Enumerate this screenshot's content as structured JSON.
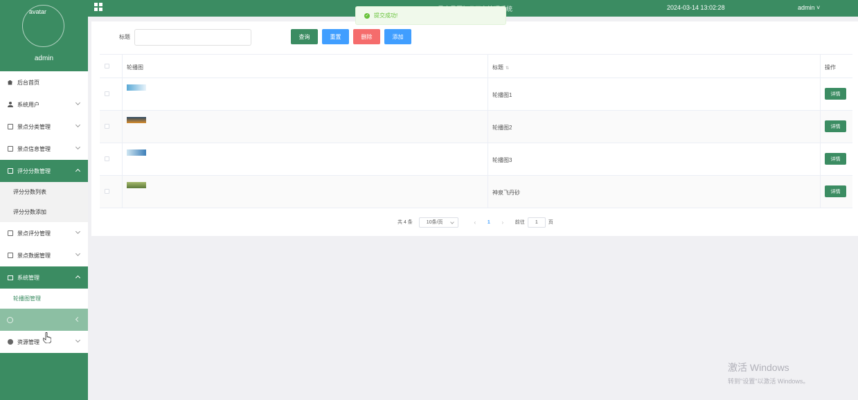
{
  "topbar": {
    "title": "景点景区打分平台管理系统",
    "datetime": "2024-03-14 13:02:28",
    "user_menu": "admin ˅"
  },
  "toast": {
    "message": "提交成功!"
  },
  "profile": {
    "avatar_alt": "avatar",
    "name": "admin"
  },
  "sidebar": {
    "items": [
      {
        "label": "后台首页",
        "icon": "home-icon"
      },
      {
        "label": "系统用户",
        "icon": "user-icon"
      },
      {
        "label": "景点分类管理",
        "icon": "edit-icon"
      },
      {
        "label": "景点信息管理",
        "icon": "edit-icon"
      },
      {
        "label": "评分分数管理",
        "icon": "edit-icon",
        "sub": [
          "评分分数列表",
          "评分分数添加"
        ]
      },
      {
        "label": "景点评分管理",
        "icon": "edit-icon"
      },
      {
        "label": "景点数据管理",
        "icon": "edit-icon"
      },
      {
        "label": "系统管理",
        "icon": "picture-icon",
        "sub": [
          "轮播图管理"
        ]
      },
      {
        "label": "",
        "icon": "info-icon"
      },
      {
        "label": "资源管理",
        "icon": "globe-icon"
      }
    ]
  },
  "search": {
    "label": "标题",
    "value": ""
  },
  "buttons": {
    "query": "查询",
    "reset": "重置",
    "delete": "删除",
    "add": "添加"
  },
  "table": {
    "headers": {
      "image": "轮播图",
      "title": "标题",
      "sort_icon": "⇅",
      "action": "操作"
    },
    "rows": [
      {
        "title": "轮播图1",
        "action": "详情",
        "thumb_colors": [
          "#5aa9d6",
          "#e8f3fa"
        ]
      },
      {
        "title": "轮播图2",
        "action": "详情",
        "thumb_colors": [
          "#2b4a66",
          "#d98c2b"
        ]
      },
      {
        "title": "轮播图3",
        "action": "详情",
        "thumb_colors": [
          "#3d7fb8",
          "#cfe6f2"
        ]
      },
      {
        "title": "神泉飞丹砂",
        "action": "详情",
        "thumb_colors": [
          "#5d7a3a",
          "#a3b86b"
        ]
      }
    ]
  },
  "pagination": {
    "total": "共 4 条",
    "page_size": "10条/页",
    "prev": "‹",
    "current": "1",
    "next": "›",
    "goto_label": "前往",
    "goto_value": "1",
    "page_suffix": "页"
  },
  "watermark": {
    "line1": "激活 Windows",
    "line2": "转到\"设置\"以激活 Windows。"
  },
  "colors": {
    "primary": "#3b8c62",
    "blue": "#409eff",
    "red": "#f56c6c",
    "success": "#67c23a"
  }
}
